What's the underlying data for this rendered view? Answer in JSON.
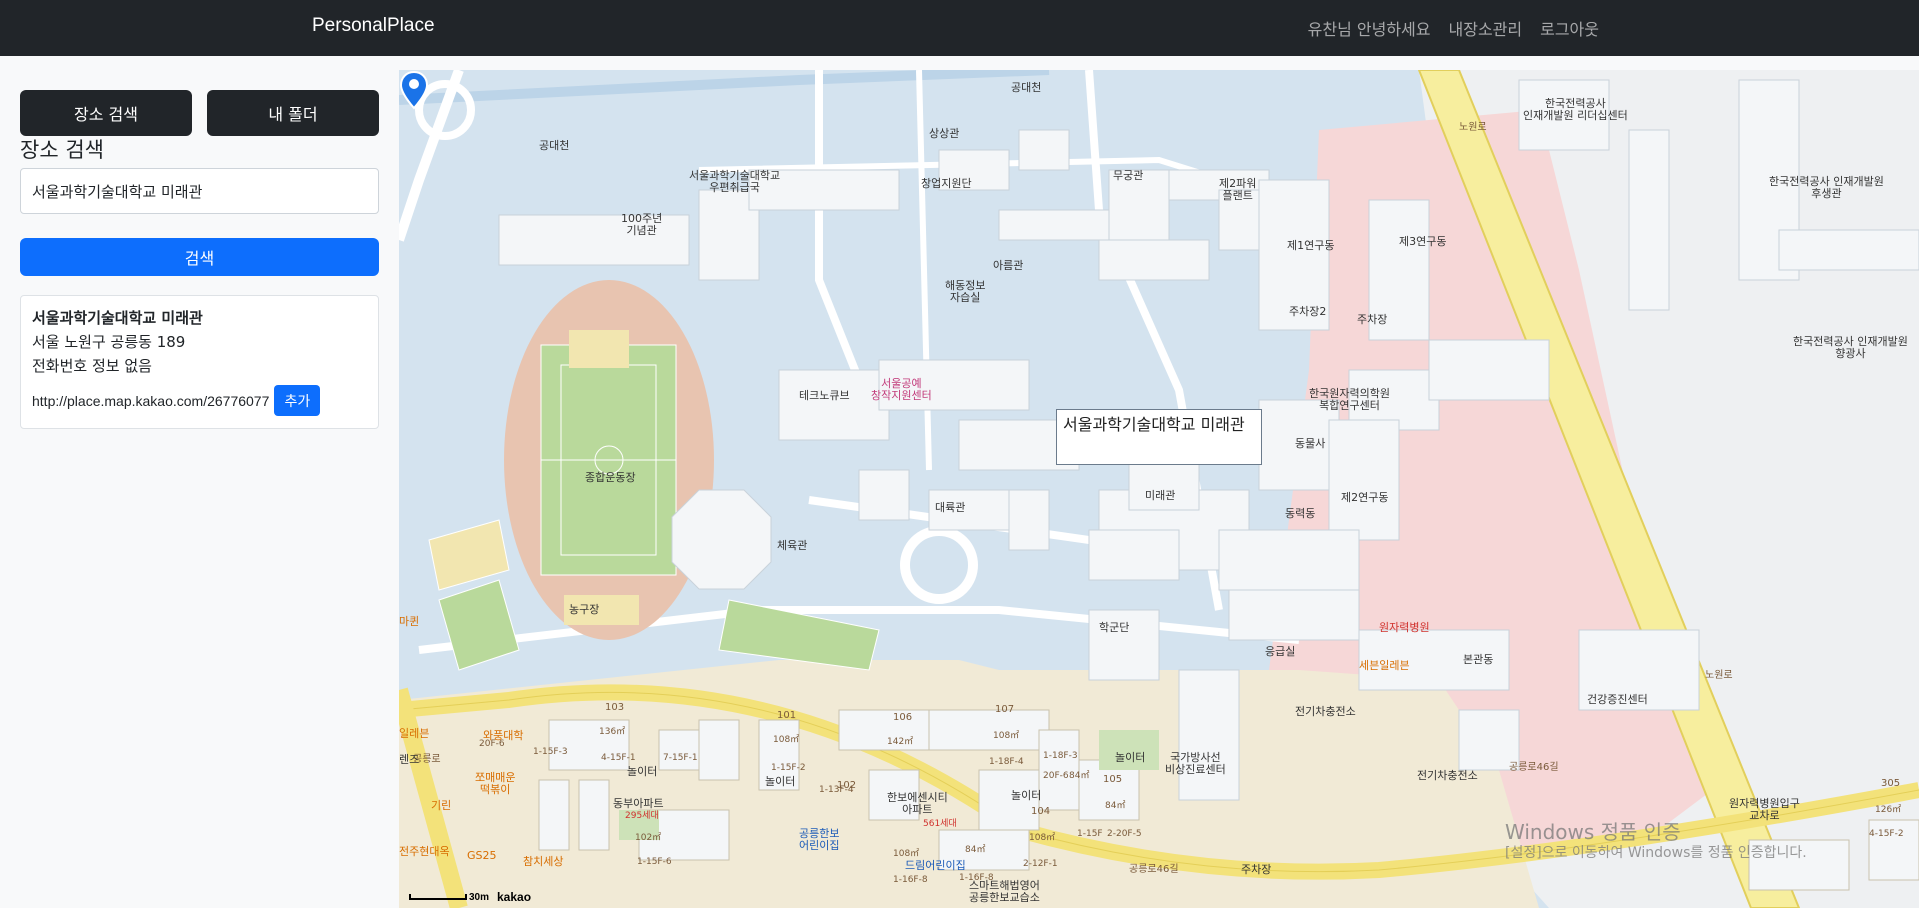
{
  "navbar": {
    "brand": "PersonalPlace",
    "greeting": "유찬님 안녕하세요",
    "manage_link": "내장소관리",
    "logout_link": "로그아웃"
  },
  "sidebar": {
    "search_tab_label": "장소 검색",
    "folder_tab_label": "내 폴더",
    "section_title": "장소 검색",
    "search_value": "서울과학기술대학교 미래관",
    "search_button_label": "검색",
    "result": {
      "name": "서울과학기술대학교 미래관",
      "address": "서울 노원구 공릉동 189",
      "phone": "전화번호 정보 없음",
      "url": "http://place.map.kakao.com/26776077",
      "add_button_label": "추가"
    }
  },
  "map": {
    "info_window": "서울과학기술대학교 미래관",
    "marker_label": "미래관",
    "labels": {
      "l01": "공대천",
      "l02": "공대천",
      "l03": "상상관",
      "l04": "서울과학기술대학교\n우편취급국",
      "l05": "창업지원단",
      "l06": "무궁관",
      "l07": "제2파워\n플랜트",
      "l08": "100주년\n기념관",
      "l09": "아름관",
      "l10": "해동정보\n자습실",
      "l11": "제1연구동",
      "l12": "제3연구동",
      "l13": "주차장2",
      "l14": "주차장",
      "l15": "테크노큐브",
      "l16": "서울공예\n창작지원센터",
      "l17": "한국원자력의학원\n복합연구센터",
      "l18": "종합운동장",
      "l19": "동물사",
      "l20": "대륙관",
      "l21": "제2연구동",
      "l22": "동력동",
      "l23": "체육관",
      "l24": "농구장",
      "l25": "학군단",
      "l26": "원자력병원",
      "l27": "응급실",
      "l28": "세븐일레븐",
      "l29": "본관동",
      "l30": "건강증진센터",
      "l31": "전기차충전소",
      "l32": "전기차충전소",
      "l33": "국가방사선\n비상진료센터",
      "l34": "한국전력공사\n인재개발원 리더십센터",
      "l35": "한국전력공사 인재개발원\n후생관",
      "l36": "한국전력공사 인재개발원\n향광사",
      "l37": "원자력병원입구\n교차로",
      "l38": "동부아파트",
      "l39": "한보에센시티\n아파트",
      "l40": "공릉한보\n어린이집",
      "l41": "드림어린이집",
      "l42": "스마트해법영어\n공릉한보교습소",
      "l43": "와풍대학",
      "l44": "쪼매매운\n떡볶이",
      "l45": "기린",
      "l46": "전주현대옥",
      "l47": "GS25",
      "l48": "참치세상",
      "l49": "주차장",
      "l50": "놀이터",
      "l51": "놀이터",
      "l52": "놀이터",
      "l53": "놀이터",
      "l54": "103",
      "l55": "101",
      "l56": "106",
      "l57": "107",
      "l58": "102",
      "l59": "104",
      "l60": "105",
      "l61": "공릉로46길",
      "l62": "공릉로46길",
      "l63": "노원로",
      "l64": "노원로",
      "l65": "공릉로",
      "l66": "136㎡",
      "l67": "108㎡",
      "l68": "142㎡",
      "l69": "108㎡",
      "l70": "84㎡",
      "l71": "84㎡",
      "l72": "102㎡",
      "l73": "108㎡",
      "l74": "84㎡",
      "l75": "108㎡",
      "l76": "295세대",
      "l77": "561세대",
      "l78": "305",
      "l79": "126㎡",
      "l80": "마퀸",
      "l81": "일레븐",
      "l82": "렌즈",
      "l83": "4-15F-1",
      "l84": "1-15F-6",
      "l85": "1-15F-2",
      "l86": "1-18F-4",
      "l87": "1-16F-8",
      "l88": "1-15F",
      "l89": "2-20F-5",
      "l90": "2-12F-1",
      "l91": "4-15F-2",
      "l92": "7-15F-1",
      "l93": "1-13F-4",
      "l94": "1-18F-3",
      "l95": "20F-6",
      "l96": "20F-6",
      "l97": "1-16F-8",
      "l98": "1-15F-3"
    },
    "scale_label": "30m",
    "logo": "kakao",
    "watermark_title": "Windows 정품 인증",
    "watermark_sub": "[설정]으로 이동하여 Windows를 정품 인증합니다."
  }
}
